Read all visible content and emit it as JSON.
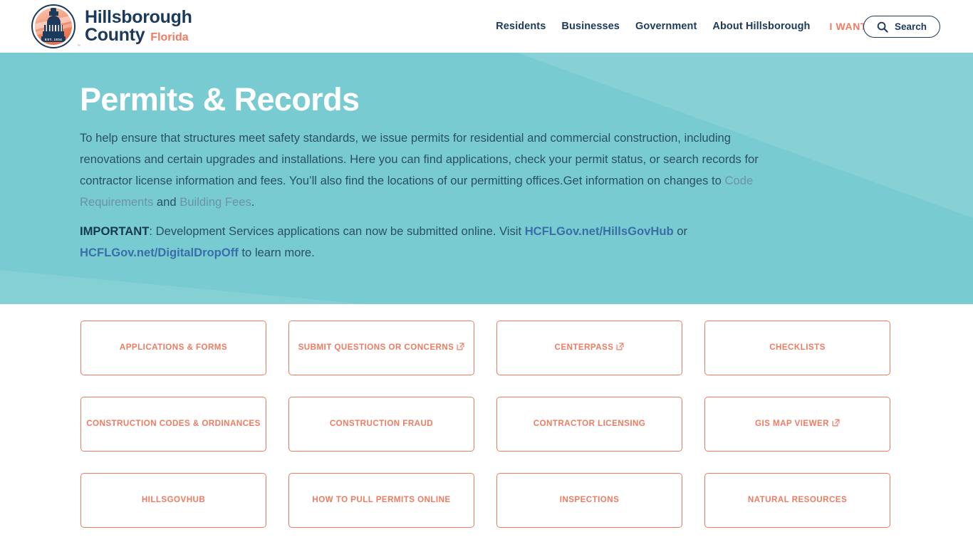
{
  "header": {
    "logo": {
      "seal_text": "EST. 1834",
      "trademark": "™",
      "name_line1": "Hillsborough",
      "name_line2": "County",
      "state": "Florida"
    },
    "nav": [
      {
        "label": "Residents",
        "name": "nav-residents"
      },
      {
        "label": "Businesses",
        "name": "nav-businesses"
      },
      {
        "label": "Government",
        "name": "nav-government"
      },
      {
        "label": "About Hillsborough",
        "name": "nav-about-hillsborough"
      }
    ],
    "i_want_to": "I WANT TO",
    "search_label": "Search"
  },
  "hero": {
    "title": "Permits & Records",
    "paragraph1": {
      "part1": "To help ensure that structures meet safety standards, we issue permits for residential and commercial construction, including renovations and certain upgrades and installations. Here you can find applications, check your permit status, or search records for contractor license information and fees. You’ll also find the locations of our permitting offices.Get information on changes to ",
      "link1": "Code Requirements",
      "part2": " and ",
      "link2": "Building Fees",
      "part3": "."
    },
    "paragraph2": {
      "important": "IMPORTANT",
      "part1": ": Development Services applications can now be submitted online. Visit ",
      "link1": "HCFLGov.net/HillsGovHub",
      "part2": " or ",
      "link2": "HCFLGov.net/DigitalDropOff",
      "part3": " to learn more."
    }
  },
  "cards": [
    {
      "label": "Applications & Forms",
      "external": false,
      "name": "card-applications-and-forms"
    },
    {
      "label": "Submit Questions or Concerns",
      "external": true,
      "name": "card-submit-questions-or-concerns"
    },
    {
      "label": "CenterPass",
      "external": true,
      "name": "card-centerpass"
    },
    {
      "label": "Checklists",
      "external": false,
      "name": "card-checklists"
    },
    {
      "label": "Construction Codes & Ordinances",
      "external": false,
      "name": "card-construction-codes-and-ordinances"
    },
    {
      "label": "Construction Fraud",
      "external": false,
      "name": "card-construction-fraud"
    },
    {
      "label": "Contractor Licensing",
      "external": false,
      "name": "card-contractor-licensing"
    },
    {
      "label": "GIS Map Viewer",
      "external": true,
      "name": "card-gis-map-viewer"
    },
    {
      "label": "HillsGovHub",
      "external": false,
      "name": "card-hillsgovhub"
    },
    {
      "label": "How to Pull Permits Online",
      "external": false,
      "name": "card-how-to-pull-permits-online"
    },
    {
      "label": "Inspections",
      "external": false,
      "name": "card-inspections"
    },
    {
      "label": "Natural Resources",
      "external": false,
      "name": "card-natural-resources"
    }
  ],
  "colors": {
    "navy": "#1b3a5c",
    "coral": "#ef7b62",
    "teal": "#78cbd1",
    "hero_text": "#2a5064",
    "link_muted": "#6b93a8",
    "link_strong": "#3a6ea8"
  }
}
